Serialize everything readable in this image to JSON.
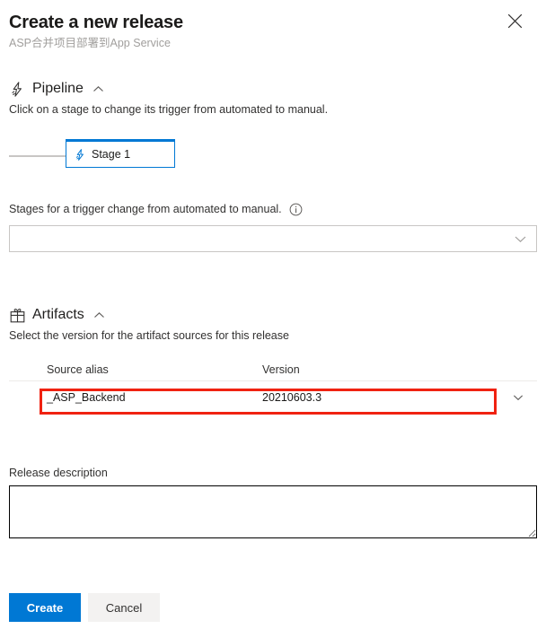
{
  "dialog": {
    "title": "Create a new release",
    "subtitle": "ASP合并项目部署到App Service",
    "close_label": "close-icon"
  },
  "pipeline": {
    "icon": "pipeline-lightning-icon",
    "heading": "Pipeline",
    "collapse_chevron": "chevron-up-icon",
    "description": "Click on a stage to change its trigger from automated to manual.",
    "stages": [
      {
        "label": "Stage 1",
        "icon": "stage-lightning-icon"
      }
    ]
  },
  "trigger": {
    "label": "Stages for a trigger change from automated to manual.",
    "info_icon": "info-icon",
    "select_value": "",
    "select_placeholder": "",
    "chevron": "chevron-down-icon"
  },
  "artifacts": {
    "icon": "artifacts-package-icon",
    "heading": "Artifacts",
    "collapse_chevron": "chevron-up-icon",
    "description": "Select the version for the artifact sources for this release",
    "columns": [
      "Source alias",
      "Version"
    ],
    "rows": [
      {
        "source_alias": "_ASP_Backend",
        "version": "20210603.3",
        "chevron": "chevron-down-icon"
      }
    ],
    "highlight_color": "#f02211"
  },
  "release_description": {
    "label": "Release description",
    "value": "",
    "placeholder": ""
  },
  "footer": {
    "create_label": "Create",
    "cancel_label": "Cancel",
    "primary_color": "#0078d4"
  }
}
